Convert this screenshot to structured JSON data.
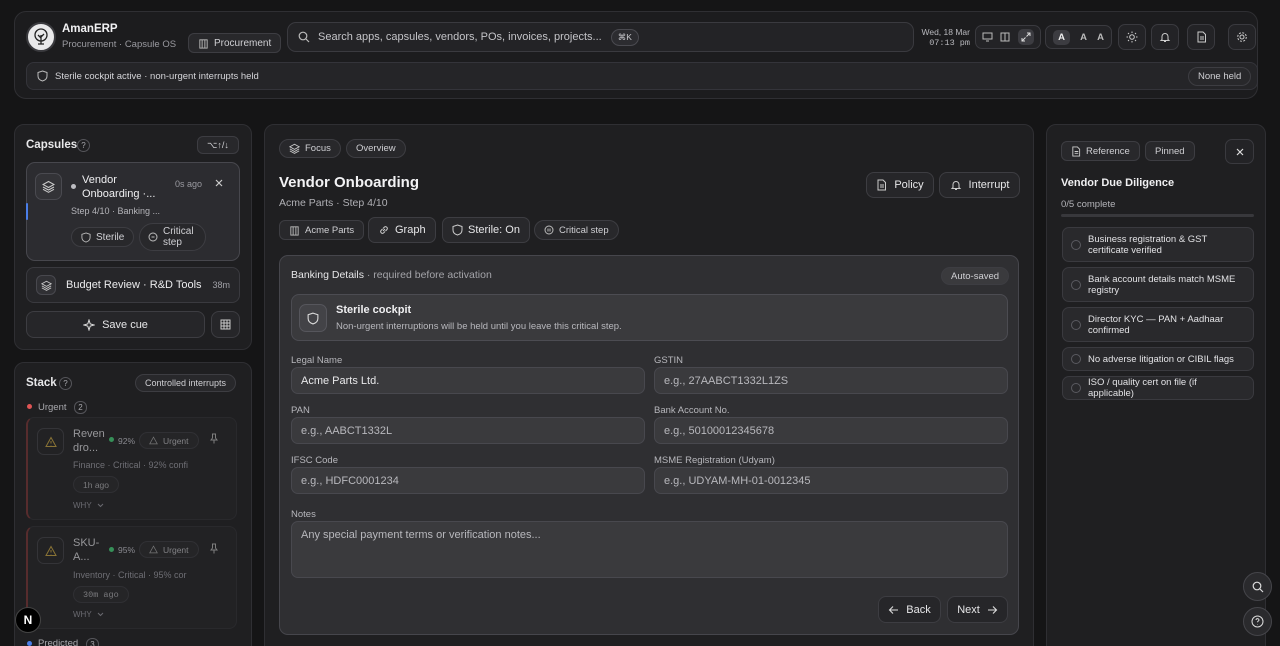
{
  "header": {
    "app_name": "AmanERP",
    "app_sub": "Procurement · Capsule OS",
    "workspace_chip": "Procurement",
    "search_placeholder": "Search apps, capsules, vendors, POs, invoices, projects...",
    "search_kbd": "⌘K",
    "date": "Wed, 18 Mar",
    "time": "07:13 pm",
    "font_sizes": [
      "A",
      "A",
      "A"
    ]
  },
  "status_bar": {
    "text": "Sterile cockpit active · non-urgent interrupts held",
    "badge": "None held"
  },
  "capsules": {
    "title": "Capsules",
    "help": "?",
    "kbd": "⌥↑/↓",
    "active": {
      "title": "Vendor Onboarding ·...",
      "time": "0s ago",
      "sub": "Step 4/10 · Banking ...",
      "chip_sterile": "Sterile",
      "chip_critical": "Critical step"
    },
    "other": {
      "title": "Budget Review · R&D Tools",
      "time": "38m"
    },
    "save_cue": "Save cue"
  },
  "stack": {
    "title": "Stack",
    "help": "?",
    "button": "Controlled interrupts",
    "urgent_label": "Urgent",
    "urgent_count": "2",
    "items": [
      {
        "title": "Reven dro...",
        "pct": "92%",
        "badge": "Urgent",
        "sub": "Finance · Critical · 92% confi",
        "ago": "1h ago",
        "why": "WHY"
      },
      {
        "title": "SKU- A...",
        "pct": "95%",
        "badge": "Urgent",
        "sub": "Inventory · Critical · 95% cor",
        "ago": "30m ago",
        "why": "WHY"
      }
    ],
    "predicted_label": "Predicted",
    "predicted_count": "3"
  },
  "main": {
    "tabs": [
      "Focus",
      "Overview"
    ],
    "title": "Vendor Onboarding",
    "subtitle": "Acme Parts · Step 4/10",
    "policy": "Policy",
    "interrupt": "Interrupt",
    "chips": {
      "vendor": "Acme Parts",
      "graph": "Graph",
      "sterile": "Sterile: On",
      "critical": "Critical step"
    },
    "form": {
      "section_title": "Banking Details",
      "section_sub": " · required before activation",
      "autosaved": "Auto-saved",
      "cockpit_title": "Sterile cockpit",
      "cockpit_text": "Non-urgent interruptions will be held until you leave this critical step.",
      "legal_name_label": "Legal Name",
      "legal_name_value": "Acme Parts Ltd.",
      "gstin_label": "GSTIN",
      "gstin_placeholder": "e.g., 27AABCT1332L1ZS",
      "pan_label": "PAN",
      "pan_placeholder": "e.g., AABCT1332L",
      "bank_label": "Bank Account No.",
      "bank_placeholder": "e.g., 50100012345678",
      "ifsc_label": "IFSC Code",
      "ifsc_placeholder": "e.g., HDFC0001234",
      "msme_label": "MSME Registration (Udyam)",
      "msme_placeholder": "e.g., UDYAM-MH-01-0012345",
      "notes_label": "Notes",
      "notes_placeholder": "Any special payment terms or verification notes...",
      "back": "Back",
      "next": "Next"
    }
  },
  "reference": {
    "chip": "Reference",
    "pinned": "Pinned",
    "title": "Vendor Due Diligence",
    "progress": "0/5 complete",
    "progress_value": 0,
    "items": [
      "Business registration & GST certificate verified",
      "Bank account details match MSME registry",
      "Director KYC — PAN + Aadhaar confirmed",
      "No adverse litigation or CIBIL flags",
      "ISO / quality cert on file (if applicable)"
    ]
  },
  "colors": {
    "urgent": "#e05555",
    "ok": "#3fbf6f",
    "accent": "#4a7ee8"
  }
}
